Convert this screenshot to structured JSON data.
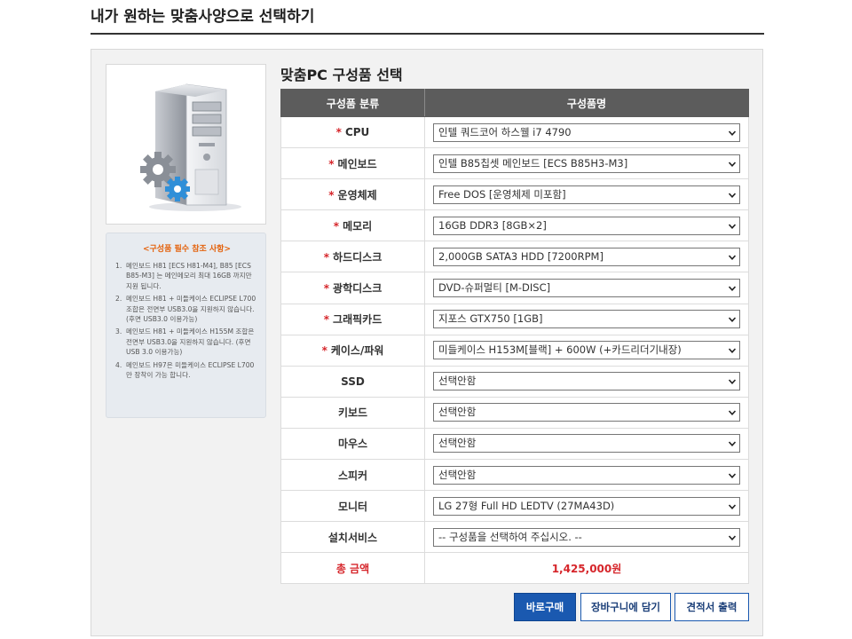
{
  "page": {
    "title": "내가 원하는 맞춤사양으로 선택하기"
  },
  "section": {
    "title": "맞춤PC 구성품 선택"
  },
  "table": {
    "header_category": "구성품 분류",
    "header_name": "구성품명",
    "rows": [
      {
        "label": "CPU",
        "required": true,
        "value": "인텔 쿼드코어 하스웰 i7 4790"
      },
      {
        "label": "메인보드",
        "required": true,
        "value": "인텔 B85칩셋 메인보드 [ECS B85H3-M3]"
      },
      {
        "label": "운영체제",
        "required": true,
        "value": "Free DOS [운영체제 미포함]"
      },
      {
        "label": "메모리",
        "required": true,
        "value": "16GB DDR3 [8GB×2]"
      },
      {
        "label": "하드디스크",
        "required": true,
        "value": "2,000GB SATA3 HDD [7200RPM]"
      },
      {
        "label": "광학디스크",
        "required": true,
        "value": "DVD-슈퍼멀티 [M-DISC]"
      },
      {
        "label": "그래픽카드",
        "required": true,
        "value": "지포스 GTX750 [1GB]"
      },
      {
        "label": "케이스/파워",
        "required": true,
        "value": "미들케이스 H153M[블랙] + 600W (+카드리더기내장)"
      },
      {
        "label": "SSD",
        "required": false,
        "value": "선택안함"
      },
      {
        "label": "키보드",
        "required": false,
        "value": "선택안함"
      },
      {
        "label": "마우스",
        "required": false,
        "value": "선택안함"
      },
      {
        "label": "스피커",
        "required": false,
        "value": "선택안함"
      },
      {
        "label": "모니터",
        "required": false,
        "value": "LG 27형 Full HD LEDTV (27MA43D)"
      },
      {
        "label": "설치서비스",
        "required": false,
        "value": "-- 구성품을 선택하여 주십시오. --"
      }
    ],
    "required_mark": "*",
    "total_label": "총 금액",
    "total_value": "1,425,000원"
  },
  "notes": {
    "title": "<구성품 필수 참조 사항>",
    "items": [
      {
        "num": "1.",
        "text": "메인보드 H81 [ECS H81-M4], B85 [ECS B85-M3] 는 메인메모리 최대 16GB 까지만 지원 됩니다."
      },
      {
        "num": "2.",
        "text": "메인보드 H81 + 미들케이스 ECLIPSE L700 조합은 전면부 USB3.0을 지원하지 않습니다.(후면 USB3.0 이용가능)"
      },
      {
        "num": "3.",
        "text": "메인보드 H81 + 미들케이스 H155M 조합은 전면부 USB3.0을 지원하지 않습니다. (후면 USB 3.0 이용가능)"
      },
      {
        "num": "4.",
        "text": "메인보드 H97은 미들케이스 ECLIPSE L700만 장착이 가능 합니다."
      }
    ]
  },
  "buttons": {
    "buy": "바로구매",
    "cart": "장바구니에 담기",
    "quote": "견적서 출력"
  },
  "colors": {
    "accent_blue": "#1a59b0",
    "required_red": "#d6262b",
    "notes_orange": "#e4620c",
    "header_gray": "#5c5c5c"
  },
  "icons": {
    "pc_image": "computer-tower-with-gears-icon",
    "select_arrow": "chevron-down-icon"
  }
}
